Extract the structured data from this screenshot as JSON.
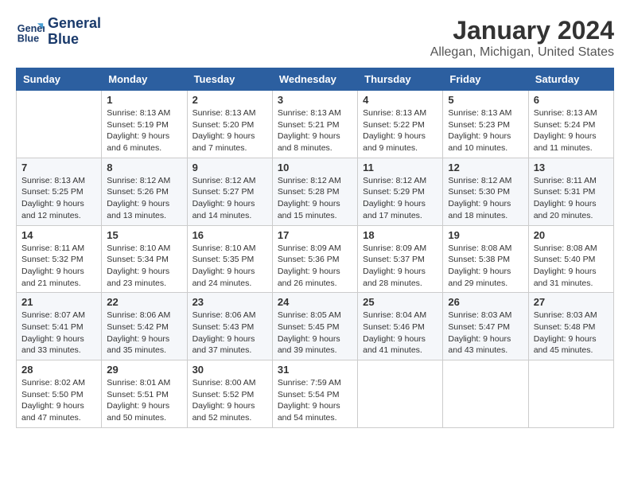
{
  "logo": {
    "line1": "General",
    "line2": "Blue"
  },
  "title": "January 2024",
  "subtitle": "Allegan, Michigan, United States",
  "headers": [
    "Sunday",
    "Monday",
    "Tuesday",
    "Wednesday",
    "Thursday",
    "Friday",
    "Saturday"
  ],
  "weeks": [
    [
      {
        "day": "",
        "sunrise": "",
        "sunset": "",
        "daylight": ""
      },
      {
        "day": "1",
        "sunrise": "Sunrise: 8:13 AM",
        "sunset": "Sunset: 5:19 PM",
        "daylight": "Daylight: 9 hours and 6 minutes."
      },
      {
        "day": "2",
        "sunrise": "Sunrise: 8:13 AM",
        "sunset": "Sunset: 5:20 PM",
        "daylight": "Daylight: 9 hours and 7 minutes."
      },
      {
        "day": "3",
        "sunrise": "Sunrise: 8:13 AM",
        "sunset": "Sunset: 5:21 PM",
        "daylight": "Daylight: 9 hours and 8 minutes."
      },
      {
        "day": "4",
        "sunrise": "Sunrise: 8:13 AM",
        "sunset": "Sunset: 5:22 PM",
        "daylight": "Daylight: 9 hours and 9 minutes."
      },
      {
        "day": "5",
        "sunrise": "Sunrise: 8:13 AM",
        "sunset": "Sunset: 5:23 PM",
        "daylight": "Daylight: 9 hours and 10 minutes."
      },
      {
        "day": "6",
        "sunrise": "Sunrise: 8:13 AM",
        "sunset": "Sunset: 5:24 PM",
        "daylight": "Daylight: 9 hours and 11 minutes."
      }
    ],
    [
      {
        "day": "7",
        "sunrise": "Sunrise: 8:13 AM",
        "sunset": "Sunset: 5:25 PM",
        "daylight": "Daylight: 9 hours and 12 minutes."
      },
      {
        "day": "8",
        "sunrise": "Sunrise: 8:12 AM",
        "sunset": "Sunset: 5:26 PM",
        "daylight": "Daylight: 9 hours and 13 minutes."
      },
      {
        "day": "9",
        "sunrise": "Sunrise: 8:12 AM",
        "sunset": "Sunset: 5:27 PM",
        "daylight": "Daylight: 9 hours and 14 minutes."
      },
      {
        "day": "10",
        "sunrise": "Sunrise: 8:12 AM",
        "sunset": "Sunset: 5:28 PM",
        "daylight": "Daylight: 9 hours and 15 minutes."
      },
      {
        "day": "11",
        "sunrise": "Sunrise: 8:12 AM",
        "sunset": "Sunset: 5:29 PM",
        "daylight": "Daylight: 9 hours and 17 minutes."
      },
      {
        "day": "12",
        "sunrise": "Sunrise: 8:12 AM",
        "sunset": "Sunset: 5:30 PM",
        "daylight": "Daylight: 9 hours and 18 minutes."
      },
      {
        "day": "13",
        "sunrise": "Sunrise: 8:11 AM",
        "sunset": "Sunset: 5:31 PM",
        "daylight": "Daylight: 9 hours and 20 minutes."
      }
    ],
    [
      {
        "day": "14",
        "sunrise": "Sunrise: 8:11 AM",
        "sunset": "Sunset: 5:32 PM",
        "daylight": "Daylight: 9 hours and 21 minutes."
      },
      {
        "day": "15",
        "sunrise": "Sunrise: 8:10 AM",
        "sunset": "Sunset: 5:34 PM",
        "daylight": "Daylight: 9 hours and 23 minutes."
      },
      {
        "day": "16",
        "sunrise": "Sunrise: 8:10 AM",
        "sunset": "Sunset: 5:35 PM",
        "daylight": "Daylight: 9 hours and 24 minutes."
      },
      {
        "day": "17",
        "sunrise": "Sunrise: 8:09 AM",
        "sunset": "Sunset: 5:36 PM",
        "daylight": "Daylight: 9 hours and 26 minutes."
      },
      {
        "day": "18",
        "sunrise": "Sunrise: 8:09 AM",
        "sunset": "Sunset: 5:37 PM",
        "daylight": "Daylight: 9 hours and 28 minutes."
      },
      {
        "day": "19",
        "sunrise": "Sunrise: 8:08 AM",
        "sunset": "Sunset: 5:38 PM",
        "daylight": "Daylight: 9 hours and 29 minutes."
      },
      {
        "day": "20",
        "sunrise": "Sunrise: 8:08 AM",
        "sunset": "Sunset: 5:40 PM",
        "daylight": "Daylight: 9 hours and 31 minutes."
      }
    ],
    [
      {
        "day": "21",
        "sunrise": "Sunrise: 8:07 AM",
        "sunset": "Sunset: 5:41 PM",
        "daylight": "Daylight: 9 hours and 33 minutes."
      },
      {
        "day": "22",
        "sunrise": "Sunrise: 8:06 AM",
        "sunset": "Sunset: 5:42 PM",
        "daylight": "Daylight: 9 hours and 35 minutes."
      },
      {
        "day": "23",
        "sunrise": "Sunrise: 8:06 AM",
        "sunset": "Sunset: 5:43 PM",
        "daylight": "Daylight: 9 hours and 37 minutes."
      },
      {
        "day": "24",
        "sunrise": "Sunrise: 8:05 AM",
        "sunset": "Sunset: 5:45 PM",
        "daylight": "Daylight: 9 hours and 39 minutes."
      },
      {
        "day": "25",
        "sunrise": "Sunrise: 8:04 AM",
        "sunset": "Sunset: 5:46 PM",
        "daylight": "Daylight: 9 hours and 41 minutes."
      },
      {
        "day": "26",
        "sunrise": "Sunrise: 8:03 AM",
        "sunset": "Sunset: 5:47 PM",
        "daylight": "Daylight: 9 hours and 43 minutes."
      },
      {
        "day": "27",
        "sunrise": "Sunrise: 8:03 AM",
        "sunset": "Sunset: 5:48 PM",
        "daylight": "Daylight: 9 hours and 45 minutes."
      }
    ],
    [
      {
        "day": "28",
        "sunrise": "Sunrise: 8:02 AM",
        "sunset": "Sunset: 5:50 PM",
        "daylight": "Daylight: 9 hours and 47 minutes."
      },
      {
        "day": "29",
        "sunrise": "Sunrise: 8:01 AM",
        "sunset": "Sunset: 5:51 PM",
        "daylight": "Daylight: 9 hours and 50 minutes."
      },
      {
        "day": "30",
        "sunrise": "Sunrise: 8:00 AM",
        "sunset": "Sunset: 5:52 PM",
        "daylight": "Daylight: 9 hours and 52 minutes."
      },
      {
        "day": "31",
        "sunrise": "Sunrise: 7:59 AM",
        "sunset": "Sunset: 5:54 PM",
        "daylight": "Daylight: 9 hours and 54 minutes."
      },
      {
        "day": "",
        "sunrise": "",
        "sunset": "",
        "daylight": ""
      },
      {
        "day": "",
        "sunrise": "",
        "sunset": "",
        "daylight": ""
      },
      {
        "day": "",
        "sunrise": "",
        "sunset": "",
        "daylight": ""
      }
    ]
  ]
}
